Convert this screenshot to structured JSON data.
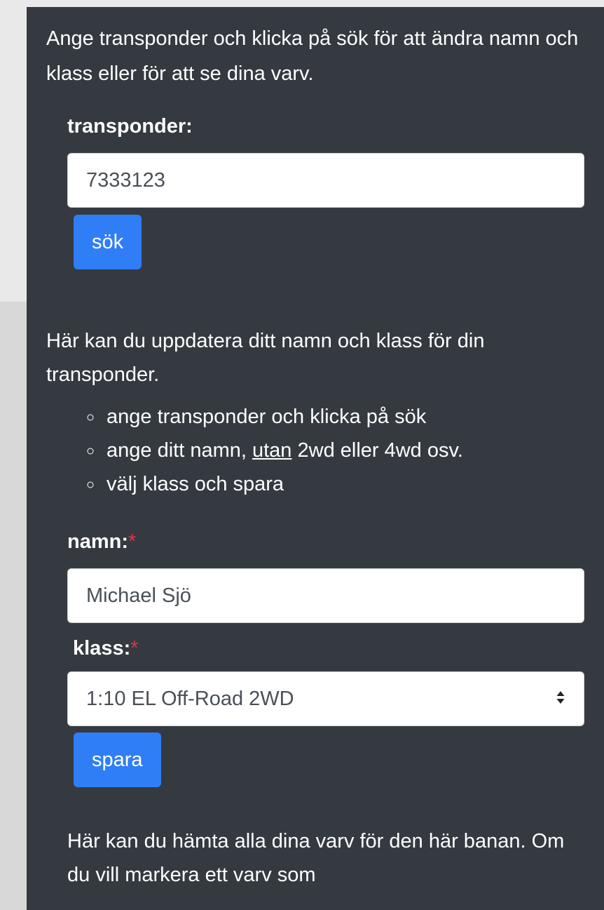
{
  "search_section": {
    "intro": "Ange transponder och klicka på sök för att ändra namn och klass eller för att se dina varv.",
    "transponder_label": "transponder:",
    "transponder_value": "7333123",
    "search_button": "sök"
  },
  "update_section": {
    "intro": "Här kan du uppdatera ditt namn och klass för din transponder.",
    "steps": [
      {
        "text": "ange transponder och klicka på sök"
      },
      {
        "pre": "ange ditt namn, ",
        "emph": "utan",
        "post": " 2wd eller 4wd osv."
      },
      {
        "text": "välj klass och spara"
      }
    ],
    "name_label": "namn:",
    "required_mark": "*",
    "name_value": "Michael Sjö",
    "class_label": "klass:",
    "class_value": "1:10 EL Off-Road 2WD",
    "save_button": "spara"
  },
  "laps_section": {
    "intro": "Här kan du hämta alla dina varv för den här banan. Om du vill markera ett varv som"
  },
  "icons": {
    "select_arrow": "sort-arrows-icon"
  }
}
